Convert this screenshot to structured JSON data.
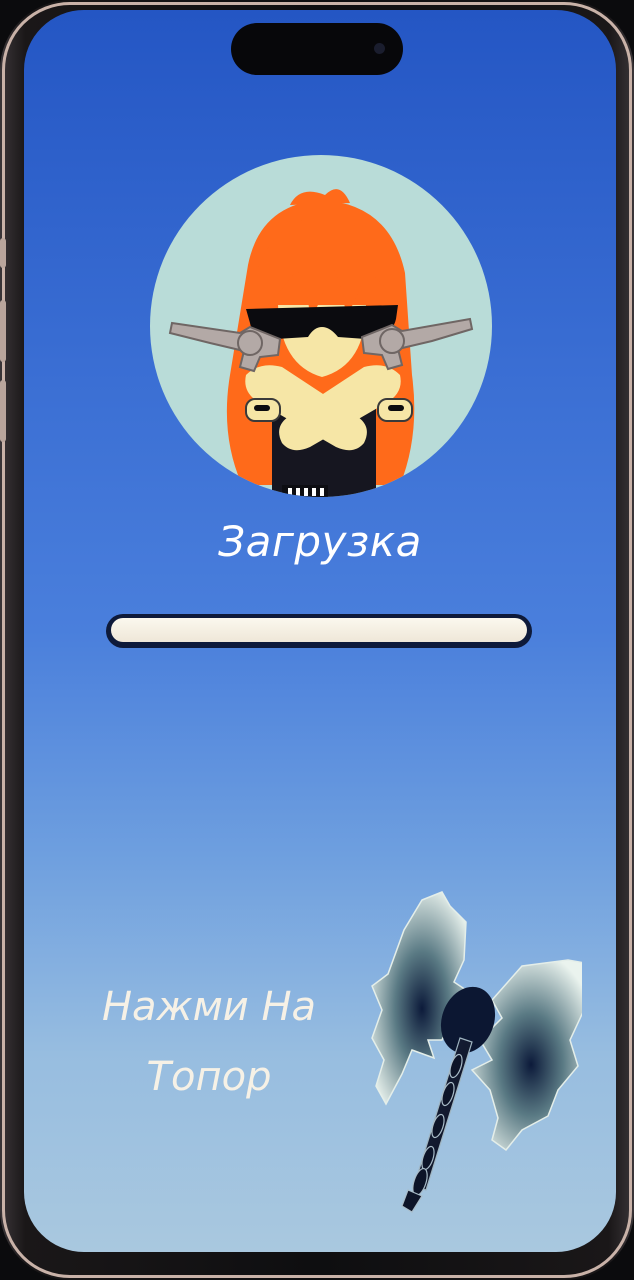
{
  "loading": {
    "label": "Загрузка",
    "progress_fraction": 1.0
  },
  "hint": {
    "line1": "Нажми На",
    "line2": "Топор"
  },
  "icons": {
    "avatar": "avatar-gunslinger-icon",
    "axe": "axe-icon"
  },
  "colors": {
    "background_top": "#2456c4",
    "background_bottom": "#a9c8df",
    "avatar_circle": "#b9dcd8",
    "hair": "#ff6a1a",
    "text": "#ffffff"
  }
}
